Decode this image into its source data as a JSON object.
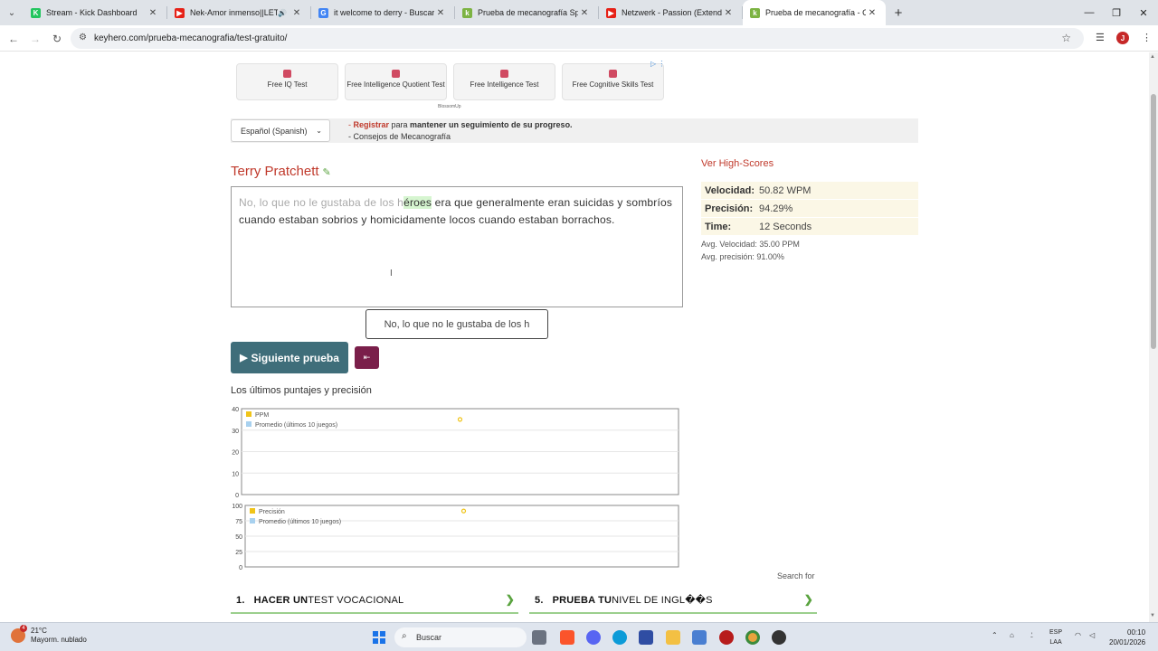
{
  "browser": {
    "tabs": [
      {
        "title": "Stream - Kick Dashboard",
        "fav_color": "#22c55e",
        "fav_glyph": "K"
      },
      {
        "title": "Nek-Amor inmenso||LETRA",
        "fav_color": "#e62117",
        "fav_glyph": "▶"
      },
      {
        "title": "it welcome to derry - Buscar co",
        "fav_color": "#4285f4",
        "fav_glyph": "G"
      },
      {
        "title": "Prueba de mecanografía Spanis",
        "fav_color": "#7cb342",
        "fav_glyph": "k"
      },
      {
        "title": "Netzwerk - Passion (Extended",
        "fav_color": "#e62117",
        "fav_glyph": "▶"
      },
      {
        "title": "Prueba de mecanografía - Com",
        "fav_color": "#7cb342",
        "fav_glyph": "k"
      }
    ],
    "active_tab": 5,
    "url": "keyhero.com/prueba-mecanografia/test-gratuito/",
    "profile_initial": "J"
  },
  "ads": {
    "items": [
      {
        "label": "Free IQ Test"
      },
      {
        "label": "Free Intelligence Quotient Test"
      },
      {
        "label": "Free Intelligence Test"
      },
      {
        "label": "Free Cognitive Skills Test"
      }
    ],
    "sponsor": "BlossomUp"
  },
  "register": {
    "language_select": "Español (Spanish)",
    "line1_prefix": "- ",
    "line1_link": "Registrar",
    "line1_middle": " para ",
    "line1_rest": "mantener un seguimiento de su progreso.",
    "line2": "- Consejos de Mecanografía"
  },
  "test": {
    "author": "Terry Pratchett",
    "text_done": "No, lo que no le gustaba de los h",
    "text_current_char": "é",
    "text_current_rest": "roes",
    "text_remaining": " era que generalmente eran suicidas y sombríos cuando estaban sobrios y homicidamente locos cuando estaban borrachos.",
    "typed_input": "No, lo que no le gustaba de los h",
    "next_button": "Siguiente prueba"
  },
  "results": {
    "highscores_link": "Ver High-Scores",
    "rows": [
      {
        "label": "Velocidad:",
        "value": "50.82 WPM"
      },
      {
        "label": "Precisión:",
        "value": "94.29%"
      },
      {
        "label": "Time:",
        "value": "12 Seconds"
      }
    ],
    "avg_speed": "Avg. Velocidad: 35.00 PPM",
    "avg_precision": "Avg. precisión: 91.00%"
  },
  "charts_title": "Los últimos puntajes y precisión",
  "chart_data": [
    {
      "type": "line",
      "series": [
        {
          "name": "PPM",
          "values": [
            35
          ],
          "color": "#f0c419"
        },
        {
          "name": "Promedio (últimos 10 juegos)",
          "values": [],
          "color": "#a8d1ef"
        }
      ],
      "ylim": [
        0,
        40
      ],
      "yticks": [
        "0",
        "10",
        "20",
        "30",
        "40"
      ],
      "grid": true,
      "legend": "top-left"
    },
    {
      "type": "line",
      "series": [
        {
          "name": "Precisión",
          "values": [
            91
          ],
          "color": "#f0c419"
        },
        {
          "name": "Promedio (últimos 10 juegos)",
          "values": [],
          "color": "#a8d1ef"
        }
      ],
      "ylim": [
        0,
        100
      ],
      "yticks": [
        "0",
        "25",
        "50",
        "75",
        "100"
      ],
      "grid": true,
      "legend": "top-left"
    }
  ],
  "search_for": "Search for",
  "promos": [
    {
      "num": "1.",
      "bold": "HACER UN",
      "rest": " TEST VOCACIONAL"
    },
    {
      "num": "5.",
      "bold": "PRUEBA TU",
      "rest": " NIVEL DE INGL��S"
    }
  ],
  "taskbar": {
    "weather_temp": "21°C",
    "weather_desc": "Mayorm. nublado",
    "weather_badge": "4",
    "search_placeholder": "Buscar",
    "lang_top": "ESP",
    "lang_bottom": "LAA",
    "time": "00:10",
    "date": "20/01/2026"
  }
}
